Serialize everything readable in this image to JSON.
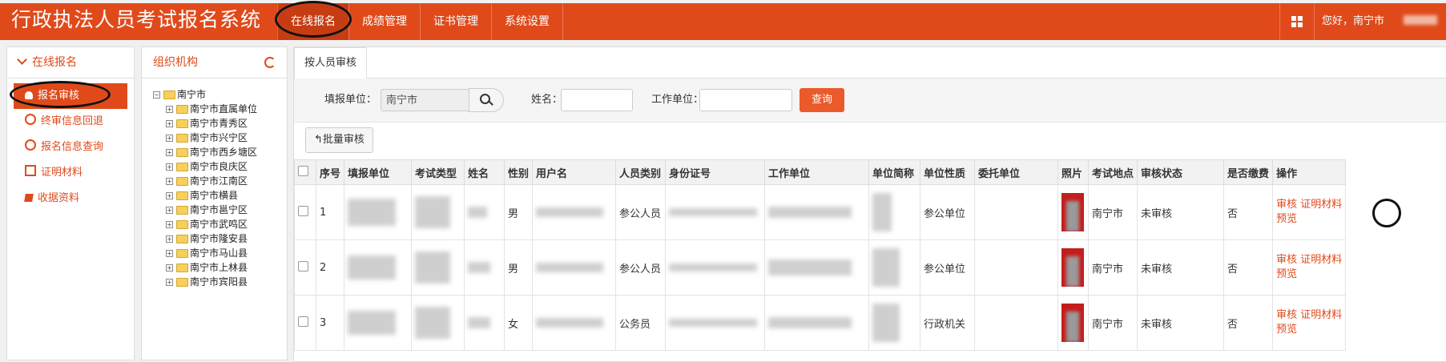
{
  "header": {
    "title": "行政执法人员考试报名系统",
    "nav": [
      {
        "label": "在线报名",
        "active": true
      },
      {
        "label": "成绩管理",
        "active": false
      },
      {
        "label": "证书管理",
        "active": false
      },
      {
        "label": "系统设置",
        "active": false
      }
    ],
    "greeting": "您好，南宁市",
    "grid_icon": "grid-icon",
    "brand_color": "#e04a1b"
  },
  "sidebar": {
    "header": "在线报名",
    "items": [
      {
        "label": "报名审核",
        "icon": "person-icon",
        "active": true
      },
      {
        "label": "终审信息回退",
        "icon": "circle-arrow-icon",
        "active": false
      },
      {
        "label": "报名信息查询",
        "icon": "circle-arrow-icon",
        "active": false
      },
      {
        "label": "证明材料",
        "icon": "document-icon",
        "active": false
      },
      {
        "label": "收据资料",
        "icon": "book-icon",
        "active": false
      }
    ]
  },
  "org": {
    "header": "组织机构",
    "root": "南宁市",
    "children": [
      "南宁市直属单位",
      "南宁市青秀区",
      "南宁市兴宁区",
      "南宁市西乡塘区",
      "南宁市良庆区",
      "南宁市江南区",
      "南宁市横县",
      "南宁市邕宁区",
      "南宁市武鸣区",
      "南宁市隆安县",
      "南宁市马山县",
      "南宁市上林县",
      "南宁市宾阳县"
    ]
  },
  "main": {
    "tab": "按人员审核",
    "search": {
      "unit_label": "填报单位：",
      "unit_value": "南宁市",
      "name_label": "姓名：",
      "name_value": "",
      "work_label": "工作单位：",
      "work_value": "",
      "query_button": "查询"
    },
    "batch_button": "批量审核",
    "columns": [
      "序号",
      "填报单位",
      "考试类型",
      "姓名",
      "性别",
      "用户名",
      "人员类别",
      "身份证号",
      "工作单位",
      "单位简称",
      "单位性质",
      "委托单位",
      "照片",
      "考试地点",
      "审核状态",
      "是否缴费",
      "操作"
    ],
    "rows": [
      {
        "no": "1",
        "gender": "男",
        "category": "参公人员",
        "nature": "参公单位",
        "location": "南宁市",
        "status": "未审核",
        "paid": "否"
      },
      {
        "no": "2",
        "gender": "男",
        "category": "参公人员",
        "nature": "参公单位",
        "location": "南宁市",
        "status": "未审核",
        "paid": "否"
      },
      {
        "no": "3",
        "gender": "女",
        "category": "公务员",
        "nature": "行政机关",
        "location": "南宁市",
        "status": "未审核",
        "paid": "否"
      }
    ],
    "ops": {
      "audit": "审核",
      "material": "证明材料",
      "preview": "预览"
    }
  }
}
